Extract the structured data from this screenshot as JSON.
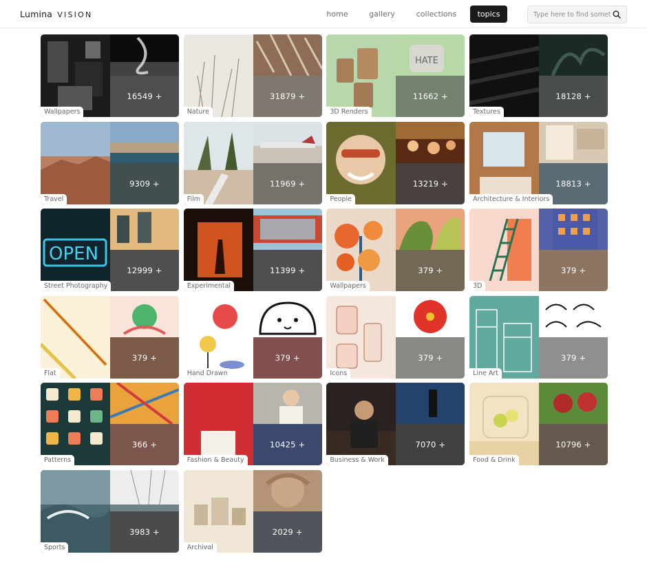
{
  "brand": {
    "name_a": "Lumina",
    "name_b": "VISION"
  },
  "nav": [
    {
      "label": "home",
      "active": false
    },
    {
      "label": "gallery",
      "active": false
    },
    {
      "label": "collections",
      "active": false
    },
    {
      "label": "topics",
      "active": true
    }
  ],
  "search": {
    "placeholder": "Type here to find something"
  },
  "topics": [
    {
      "label": "Wallpapers",
      "count": "16549 +",
      "colors": [
        "#1c1c1c",
        "#0b0b0b",
        "#3a3a3a"
      ]
    },
    {
      "label": "Nature",
      "count": "31879 +",
      "colors": [
        "#e7e3dc",
        "#8e6d58",
        "#b9a994"
      ]
    },
    {
      "label": "3D Renders",
      "count": "11662 +",
      "colors": [
        "#b9d7ad",
        "#b7d9a8",
        "#9cbf8e"
      ]
    },
    {
      "label": "Textures",
      "count": "18128 +",
      "colors": [
        "#101010",
        "#1c2a24",
        "#2a3a33"
      ]
    },
    {
      "label": "Travel",
      "count": "9309 +",
      "colors": [
        "#b98066",
        "#6e8aa6",
        "#1f3a3a"
      ]
    },
    {
      "label": "Film",
      "count": "11969 +",
      "colors": [
        "#6f7c54",
        "#c9c2b6",
        "#a39787"
      ]
    },
    {
      "label": "People",
      "count": "13219 +",
      "colors": [
        "#6b6b30",
        "#5a2a14",
        "#2a1a10"
      ]
    },
    {
      "label": "Architecture & Interiors",
      "count": "18813 +",
      "colors": [
        "#b37848",
        "#d8c9b4",
        "#5b87a3"
      ]
    },
    {
      "label": "Street Photography",
      "count": "12999 +",
      "colors": [
        "#10242e",
        "#2d3a33",
        "#3b3d3c"
      ]
    },
    {
      "label": "Experimental",
      "count": "11399 +",
      "colors": [
        "#1c0e08",
        "#9cc4d6",
        "#3e3e3e"
      ]
    },
    {
      "label": "Wallpapers",
      "count": "379 +",
      "colors": [
        "#ead9c8",
        "#e9a47d",
        "#9a7f4e"
      ]
    },
    {
      "label": "3D",
      "count": "379 +",
      "colors": [
        "#f9d9cd",
        "#5460a8",
        "#e0a070"
      ]
    },
    {
      "label": "Flat",
      "count": "379 +",
      "colors": [
        "#fbf1d9",
        "#f8e4d9",
        "#b35b2c"
      ]
    },
    {
      "label": "Hand Drawn",
      "count": "379 +",
      "colors": [
        "#ffffff",
        "#ffffff",
        "#c9413e"
      ]
    },
    {
      "label": "Icons",
      "count": "379 +",
      "colors": [
        "#f5e7dd",
        "#ffffff",
        "#cfd8c8"
      ]
    },
    {
      "label": "Line Art",
      "count": "379 +",
      "colors": [
        "#62a9a0",
        "#ffffff",
        "#e4e4e4"
      ]
    },
    {
      "label": "Patterns",
      "count": "366 +",
      "colors": [
        "#1d3a3a",
        "#e9a23c",
        "#b44f37"
      ]
    },
    {
      "label": "Fashion & Beauty",
      "count": "10425 +",
      "colors": [
        "#cf2f34",
        "#b8b5ae",
        "#0f2a8f"
      ]
    },
    {
      "label": "Business & Work",
      "count": "7070 +",
      "colors": [
        "#2a2220",
        "#23436e",
        "#1a1a1a"
      ]
    },
    {
      "label": "Food & Drink",
      "count": "10796 +",
      "colors": [
        "#f1e3c3",
        "#5c8a3a",
        "#7a5a3a"
      ]
    },
    {
      "label": "Sports",
      "count": "3983 +",
      "colors": [
        "#4c6a74",
        "#ededed",
        "#2e3438"
      ]
    },
    {
      "label": "Archival",
      "count": "2029 +",
      "colors": [
        "#efe6d6",
        "#b49479",
        "#3f4a5d"
      ]
    }
  ],
  "icons": {
    "search": "magnifier-icon"
  }
}
